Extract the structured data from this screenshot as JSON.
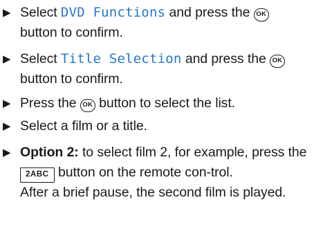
{
  "bullet_glyph": "▶",
  "steps": [
    {
      "pre": "Select ",
      "menu_item": "DVD Functions",
      "mid": " and press the ",
      "key": "OK",
      "post": " button to confirm."
    },
    {
      "pre": "Select ",
      "menu_item": "Title Selection",
      "mid": " and press the ",
      "key": "OK",
      "post": " button to confirm."
    },
    {
      "pre": "Press the ",
      "key": "OK",
      "post": " button to select the list."
    },
    {
      "text": "Select a film or a title."
    },
    {
      "label": "Option 2:",
      "pre": " to select film 2, for example, press the ",
      "key": "2ABC",
      "post": " button on the remote con-trol.",
      "note": "After a brief pause, the second film is played."
    }
  ]
}
